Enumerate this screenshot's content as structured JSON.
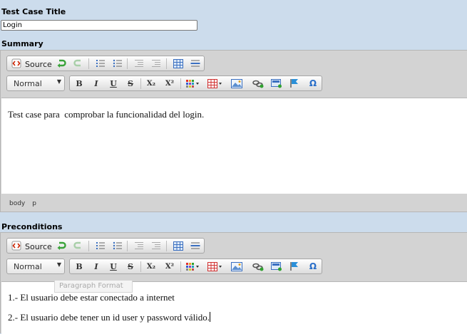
{
  "fields": {
    "title_label": "Test Case Title",
    "title_value": "Login",
    "summary_label": "Summary",
    "preconditions_label": "Preconditions"
  },
  "toolbar": {
    "source_label": "Source",
    "format_value": "Normal",
    "bold": "B",
    "italic": "I",
    "underline": "U",
    "strike": "S",
    "subscript": "X₂",
    "superscript": "X²",
    "special_char": "Ω"
  },
  "summary": {
    "text": "Test case para  comprobar la funcionalidad del login.",
    "path": [
      "body",
      "p"
    ]
  },
  "preconditions": {
    "line1": "1.- El usuario debe estar conectado a internet",
    "line2": "2.- El usuario debe tener un id user y password válido.",
    "tooltip": "Paragraph Format"
  },
  "colors": {
    "page_bg": "#ccdcec",
    "toolbar_bg": "#d3d3d3",
    "source_icon": "#cc2200",
    "undo_green": "#3aa33a",
    "link_blue": "#2a6fc9"
  }
}
